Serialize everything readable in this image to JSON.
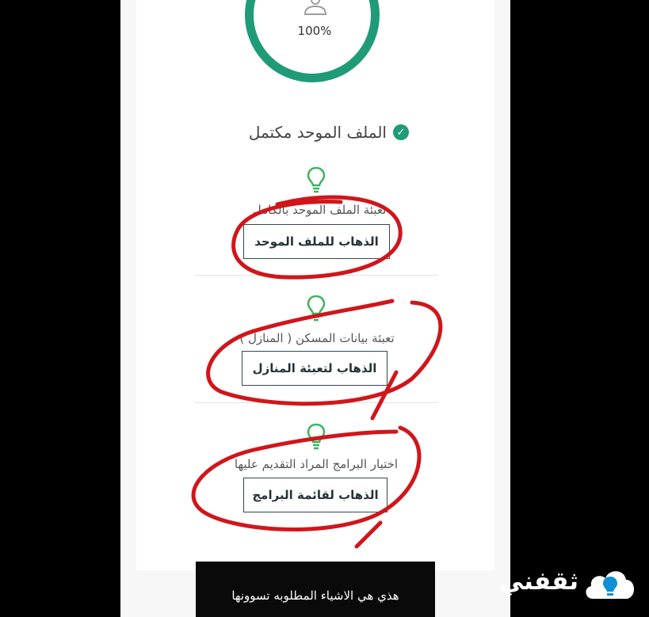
{
  "profile": {
    "percent": "100%",
    "complete_label": "الملف الموحد مكتمل"
  },
  "sections": [
    {
      "text": "تعبئة الملف الموحد بالكامل",
      "button": "الذهاب للملف الموحد"
    },
    {
      "text": "تعبئة بيانات المسكن ( المنازل )",
      "button": "الذهاب لتعبئة المنازل"
    },
    {
      "text": "اختيار البرامج المراد التقديم عليها",
      "button": "الذهاب لقائمة البرامج"
    }
  ],
  "caption": "هذي هي الاشياء المطلوبه تسوونها",
  "watermark": {
    "text": "ثقفني"
  },
  "colors": {
    "accent": "#1f9b78",
    "annotation": "#d0161b",
    "bulb": "#3db35f"
  },
  "icons": [
    "user-icon",
    "check-icon",
    "lightbulb-icon",
    "cloud-bulb-icon"
  ]
}
